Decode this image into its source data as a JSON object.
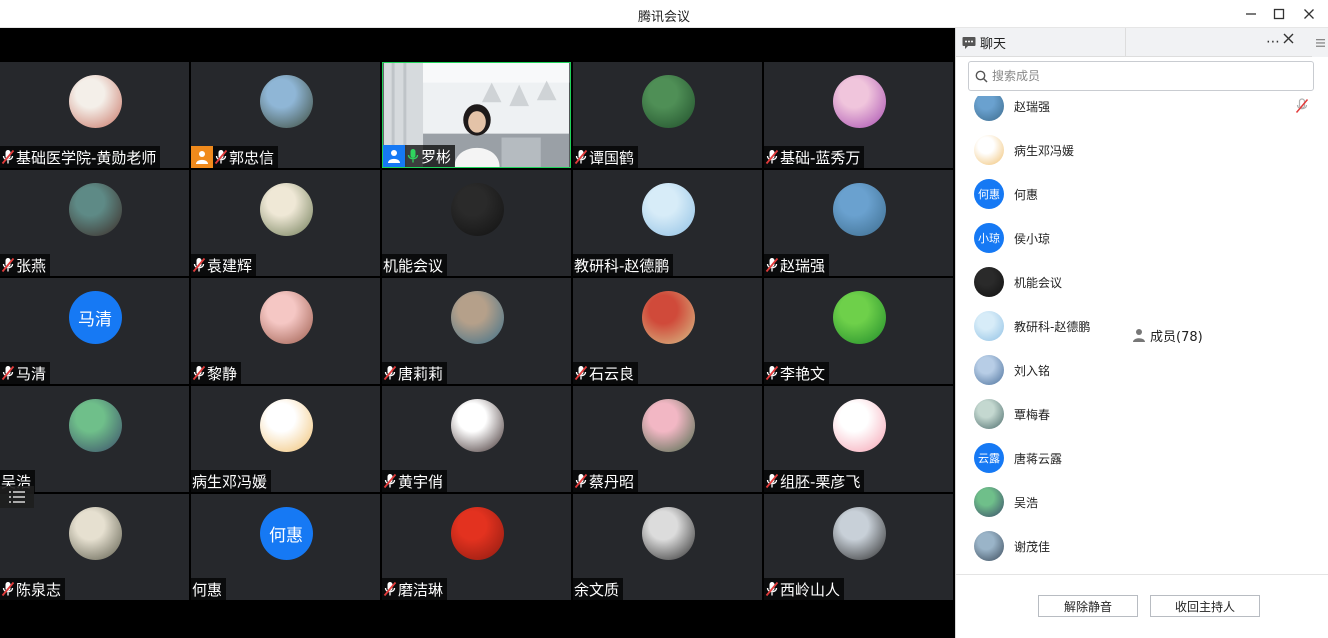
{
  "window": {
    "title": "腾讯会议"
  },
  "participants": [
    {
      "name": "基础医学院-黄勋老师",
      "muted": true,
      "avatar": "photo-hand-icon",
      "colors": [
        "#f4efe9",
        "#c87363"
      ]
    },
    {
      "name": "郭忠信",
      "muted": true,
      "host": true,
      "avatar": "photo-lake-sunset-icon",
      "colors": [
        "#8fb6d6",
        "#3c4a3a"
      ]
    },
    {
      "name": "罗彬",
      "muted": false,
      "host": true,
      "video": true,
      "avatar": "camera-feed",
      "colors": [
        "#e8ecef",
        "#7a7f86"
      ]
    },
    {
      "name": "谭国鹤",
      "muted": true,
      "avatar": "photo-lotus-leaves-icon",
      "colors": [
        "#4f8f56",
        "#1f4d2a"
      ]
    },
    {
      "name": "基础-蓝秀万",
      "muted": true,
      "avatar": "photo-portrait-pink-icon",
      "colors": [
        "#f0c5dc",
        "#a64bb0"
      ]
    },
    {
      "name": "张燕",
      "muted": true,
      "avatar": "photo-dark-art-icon",
      "colors": [
        "#5e8a86",
        "#3b2a25"
      ]
    },
    {
      "name": "袁建辉",
      "muted": true,
      "avatar": "photo-chinese-painting-icon",
      "colors": [
        "#efe8d6",
        "#6d7a55"
      ]
    },
    {
      "name": "机能会议",
      "muted": false,
      "avatar": "photo-man-dark-icon",
      "colors": [
        "#2a2a2a",
        "#111"
      ]
    },
    {
      "name": "教研科-赵德鹏",
      "muted": false,
      "avatar": "photo-sky-icon",
      "colors": [
        "#d7ecf8",
        "#8fc0e4"
      ]
    },
    {
      "name": "赵瑞强",
      "muted": true,
      "avatar": "photo-coast-icon",
      "colors": [
        "#6aa1cf",
        "#3c6b8c"
      ]
    },
    {
      "name": "马清",
      "muted": true,
      "avatar_text": "马清"
    },
    {
      "name": "黎静",
      "muted": true,
      "avatar": "photo-child-bunny-icon",
      "colors": [
        "#f5c7c4",
        "#9b5a4a"
      ]
    },
    {
      "name": "唐莉莉",
      "muted": true,
      "avatar": "photo-woman-outdoor-icon",
      "colors": [
        "#b5a08a",
        "#3b6f8a"
      ]
    },
    {
      "name": "石云良",
      "muted": true,
      "avatar": "photo-autumn-leaves-icon",
      "colors": [
        "#d04a3a",
        "#d7c28a"
      ]
    },
    {
      "name": "李艳文",
      "muted": true,
      "avatar": "photo-green-leaves-icon",
      "colors": [
        "#6ed04a",
        "#1f8a2a"
      ]
    },
    {
      "name": "吴浩",
      "muted": false,
      "avatar": "photo-ethereum-icon",
      "colors": [
        "#6fbf8a",
        "#3a4a6a"
      ]
    },
    {
      "name": "病生邓冯媛",
      "muted": false,
      "avatar": "photo-cartoon-duck-icon",
      "colors": [
        "#ffffff",
        "#f0c070"
      ]
    },
    {
      "name": "黄宇俏",
      "muted": true,
      "avatar": "photo-woman-white-icon",
      "colors": [
        "#ffffff",
        "#3a2a2a"
      ]
    },
    {
      "name": "蔡丹昭",
      "muted": true,
      "avatar": "photo-peony-icon",
      "colors": [
        "#f2b7c4",
        "#4a6a4a"
      ]
    },
    {
      "name": "组胚-栗彦飞",
      "muted": true,
      "avatar": "photo-cartoon-bunny-icon",
      "colors": [
        "#ffffff",
        "#f5a0b0"
      ]
    },
    {
      "name": "陈泉志",
      "muted": true,
      "avatar": "photo-man-desk-icon",
      "colors": [
        "#e6e0d0",
        "#5a5a4a"
      ]
    },
    {
      "name": "何惠",
      "muted": false,
      "avatar_text": "何惠"
    },
    {
      "name": "磨洁琳",
      "muted": true,
      "avatar": "photo-red-abstract-icon",
      "colors": [
        "#e3321f",
        "#8a1a10"
      ]
    },
    {
      "name": "余文质",
      "muted": false,
      "avatar": "photo-man-reading-icon",
      "colors": [
        "#dcdcdc",
        "#2a2a2a"
      ]
    },
    {
      "name": "西岭山人",
      "muted": true,
      "avatar": "photo-young-man-icon",
      "colors": [
        "#c8d0d8",
        "#2a2a2a"
      ]
    }
  ],
  "panel": {
    "tabs": {
      "chat": "聊天",
      "members": "成员(78)"
    },
    "search_placeholder": "搜索成员",
    "members": [
      {
        "name": "赵瑞强",
        "avatar": "photo-coast-icon",
        "colors": [
          "#6aa1cf",
          "#3c6b8c"
        ],
        "mic_off": true
      },
      {
        "name": "病生邓冯媛",
        "avatar": "photo-cartoon-duck-icon",
        "colors": [
          "#ffffff",
          "#f0c070"
        ]
      },
      {
        "name": "何惠",
        "avatar_text": "何惠"
      },
      {
        "name": "侯小琼",
        "avatar_text": "小琼"
      },
      {
        "name": "机能会议",
        "avatar": "photo-man-dark-icon",
        "colors": [
          "#2a2a2a",
          "#111"
        ]
      },
      {
        "name": "教研科-赵德鹏",
        "avatar": "photo-sky-icon",
        "colors": [
          "#d7ecf8",
          "#8fc0e4"
        ]
      },
      {
        "name": "刘入铭",
        "avatar": "photo-clouds-icon",
        "colors": [
          "#b7cde6",
          "#4a6f9a"
        ]
      },
      {
        "name": "覃梅春",
        "avatar": "photo-lake-icon",
        "colors": [
          "#c4d8d0",
          "#4a6a6a"
        ]
      },
      {
        "name": "唐蒋云露",
        "avatar_text": "云露"
      },
      {
        "name": "吴浩",
        "avatar": "photo-ethereum-icon",
        "colors": [
          "#6fbf8a",
          "#3a4a6a"
        ]
      },
      {
        "name": "谢茂佳",
        "avatar": "photo-horizon-icon",
        "colors": [
          "#9ab4c8",
          "#3a4a5a"
        ]
      }
    ],
    "buttons": {
      "unmute_all": "解除静音",
      "reclaim_host": "收回主持人"
    }
  },
  "colors": {
    "avatar_blue": "#1679f4",
    "active_border": "#1fd25a",
    "tile_bg": "#26282c"
  }
}
